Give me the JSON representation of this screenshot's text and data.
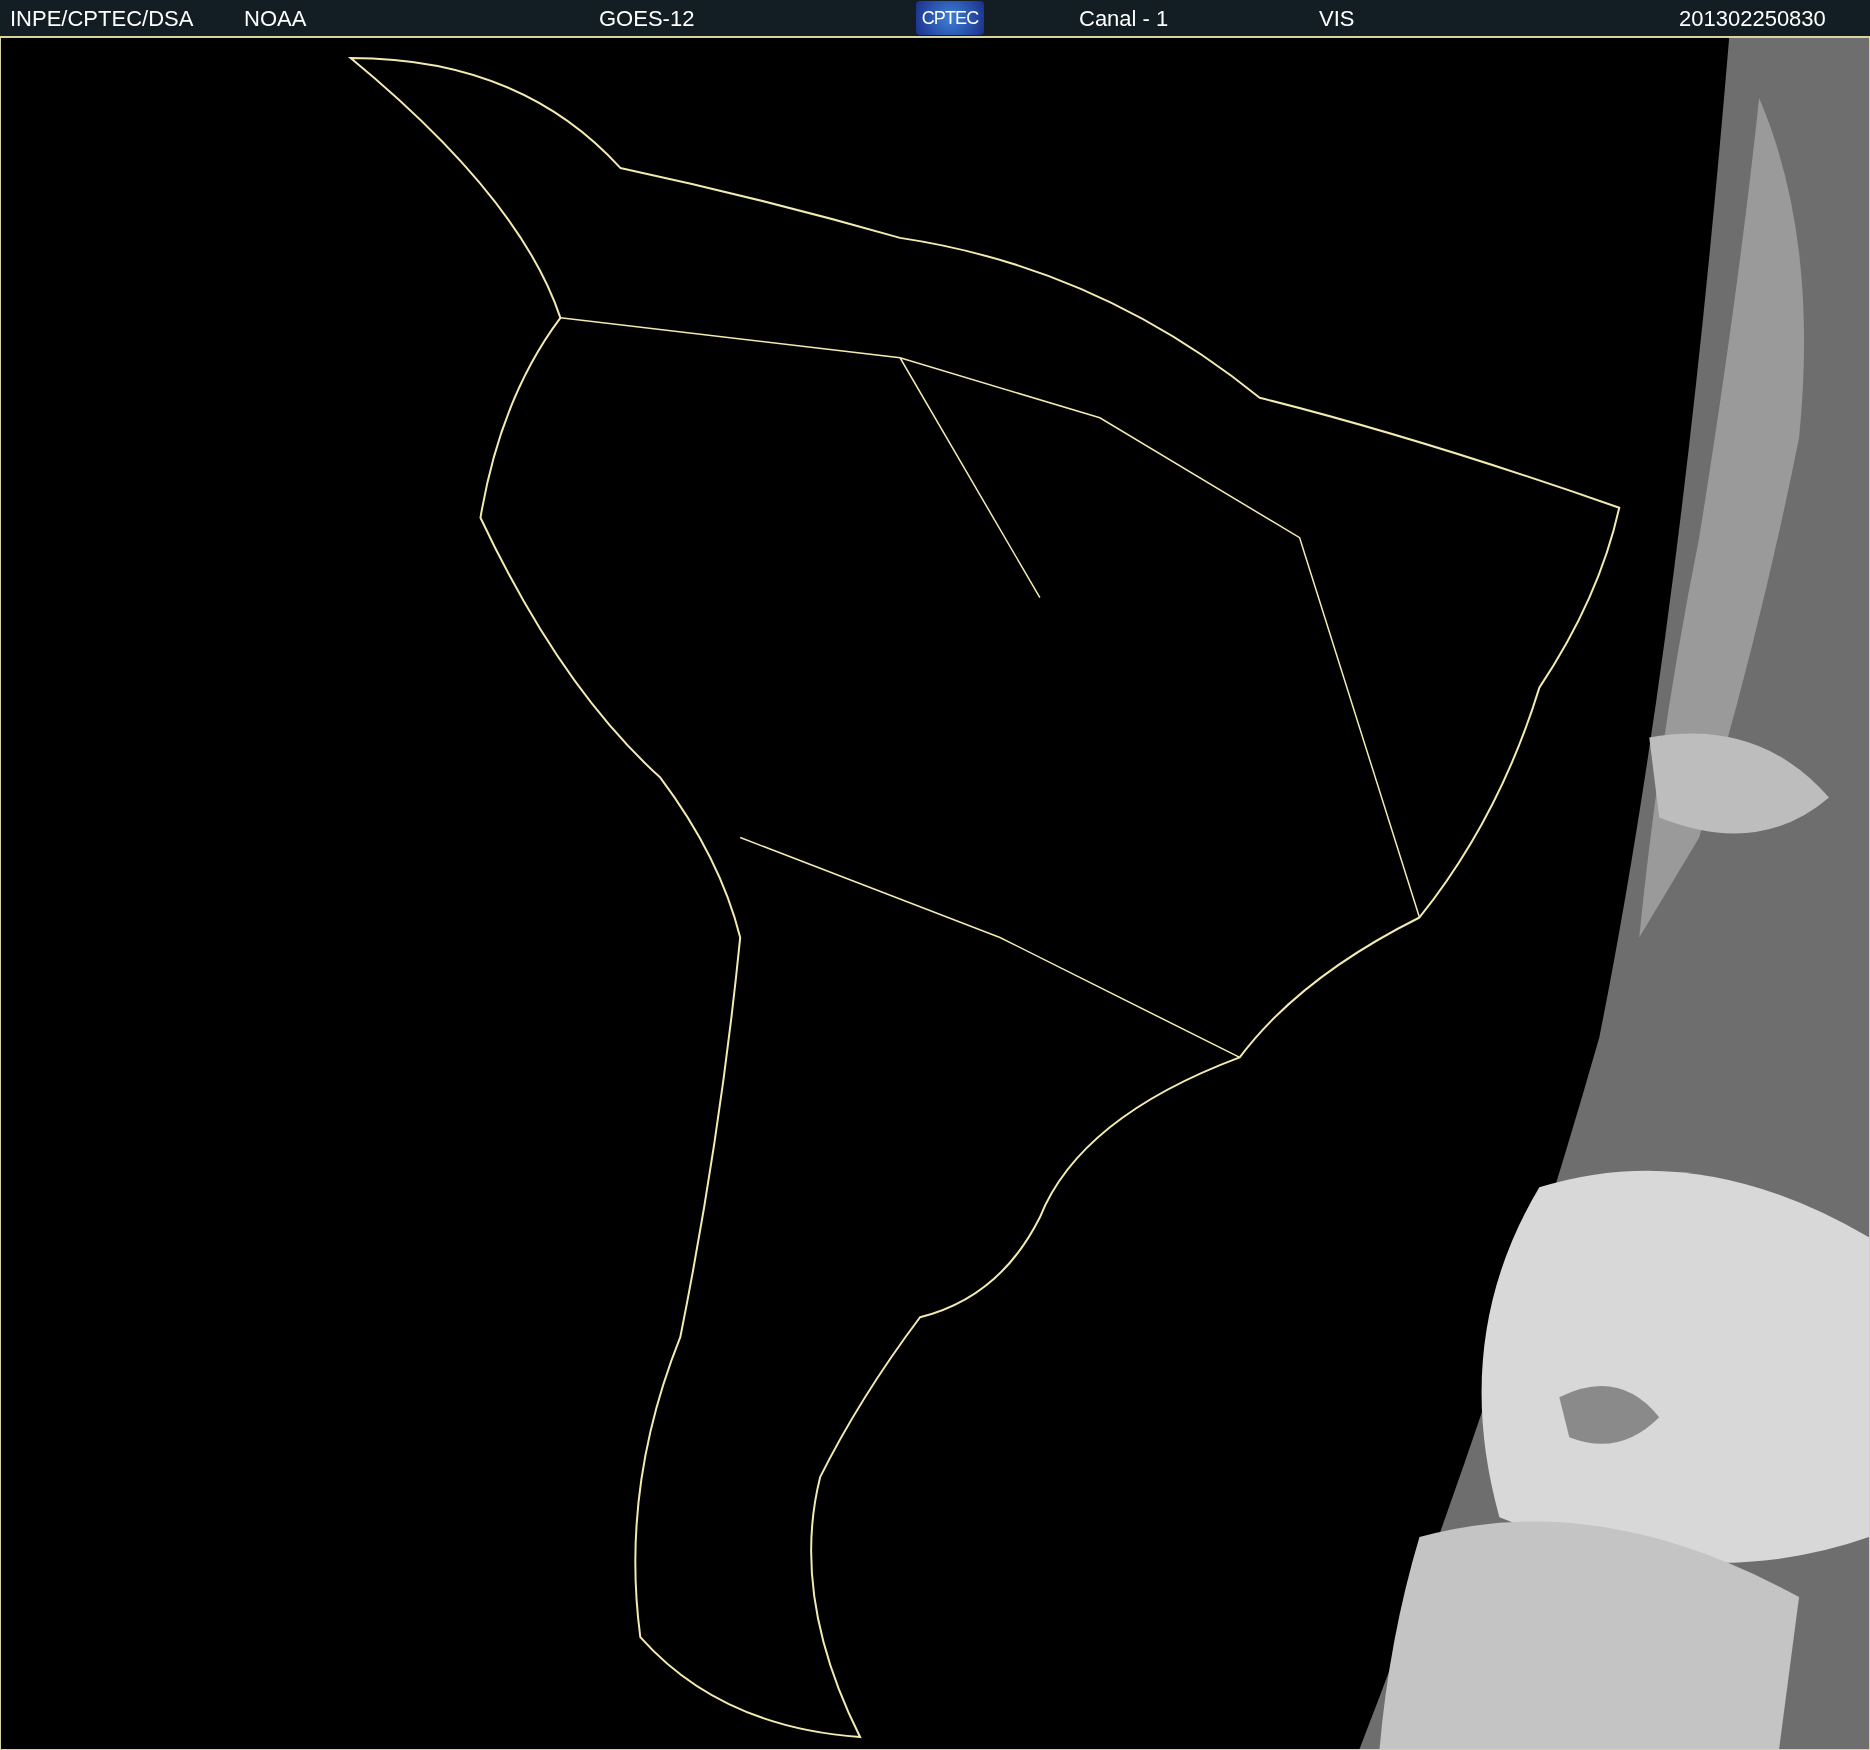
{
  "header": {
    "source": "INPE/CPTEC/DSA",
    "agency": "NOAA",
    "satellite": "GOES-12",
    "logo": "CPTEC",
    "channel": "Canal - 1",
    "band": "VIS",
    "timestamp": "201302250830"
  }
}
